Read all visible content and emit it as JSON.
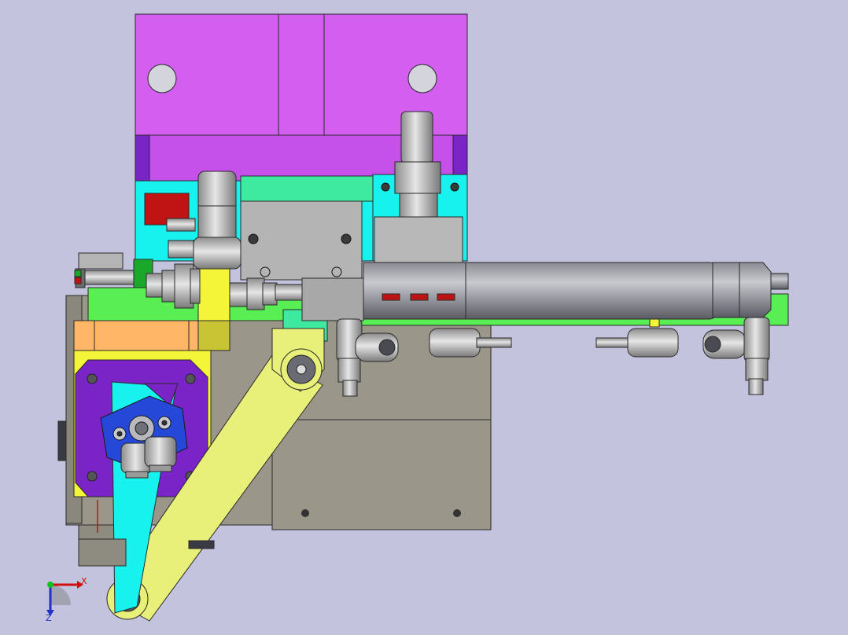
{
  "view": {
    "background": "#c3c3de",
    "colors": {
      "magenta": "#d35ef0",
      "purple": "#7a24c8",
      "cyan": "#18f2ee",
      "mint": "#3eeaa0",
      "green": "#58ee54",
      "yellow": "#f4f438",
      "lime": "#e8f07a",
      "orange": "#ffb666",
      "grey": "#9a978a",
      "steel": "#b4b4b4",
      "dark": "#5c5c6a",
      "red": "#c01414",
      "blue": "#2548d8"
    }
  },
  "triad": {
    "x_label": "X",
    "y_label": "Y",
    "z_label": "Z"
  }
}
